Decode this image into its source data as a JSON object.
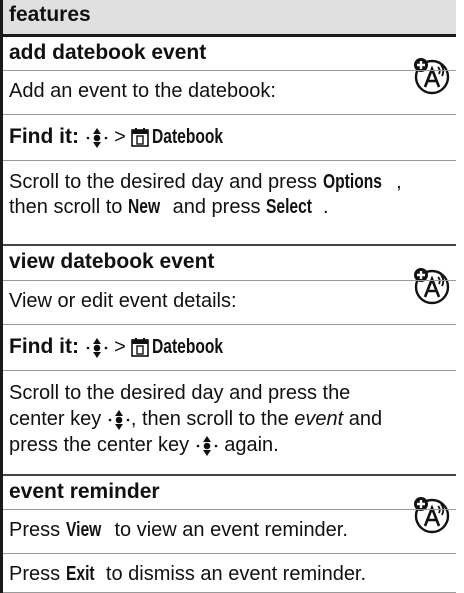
{
  "header": {
    "title": "features"
  },
  "sections": [
    {
      "title": "add datebook event",
      "intro": "Add an event to the datebook:",
      "find_label": "Find it:",
      "find_sep": ">",
      "find_target": "Datebook",
      "body": {
        "p1": "Scroll to the desired day and press ",
        "k1": "Options",
        "p2": ",",
        "p3": "then scroll to ",
        "k2": "New",
        "p4": " and press ",
        "k3": "Select",
        "p5": "."
      }
    },
    {
      "title": "view datebook event",
      "intro": "View or edit event details:",
      "find_label": "Find it:",
      "find_sep": ">",
      "find_target": "Datebook",
      "body": {
        "l1": "Scroll to the desired day and press the",
        "l2a": "center key ",
        "l2b": ", then scroll to the ",
        "l2c": "event",
        "l2d": " and",
        "l3a": "press the center key ",
        "l3b": " again."
      }
    },
    {
      "title": "event reminder",
      "line1a": "Press ",
      "line1k": "View",
      "line1b": " to view an event reminder.",
      "line2a": "Press ",
      "line2k": "Exit",
      "line2b": " to dismiss an event reminder."
    }
  ],
  "icons": {
    "nav_key": "navigation-key-icon",
    "datebook": "datebook-icon",
    "network_feature": "network-dependent-feature-icon"
  }
}
